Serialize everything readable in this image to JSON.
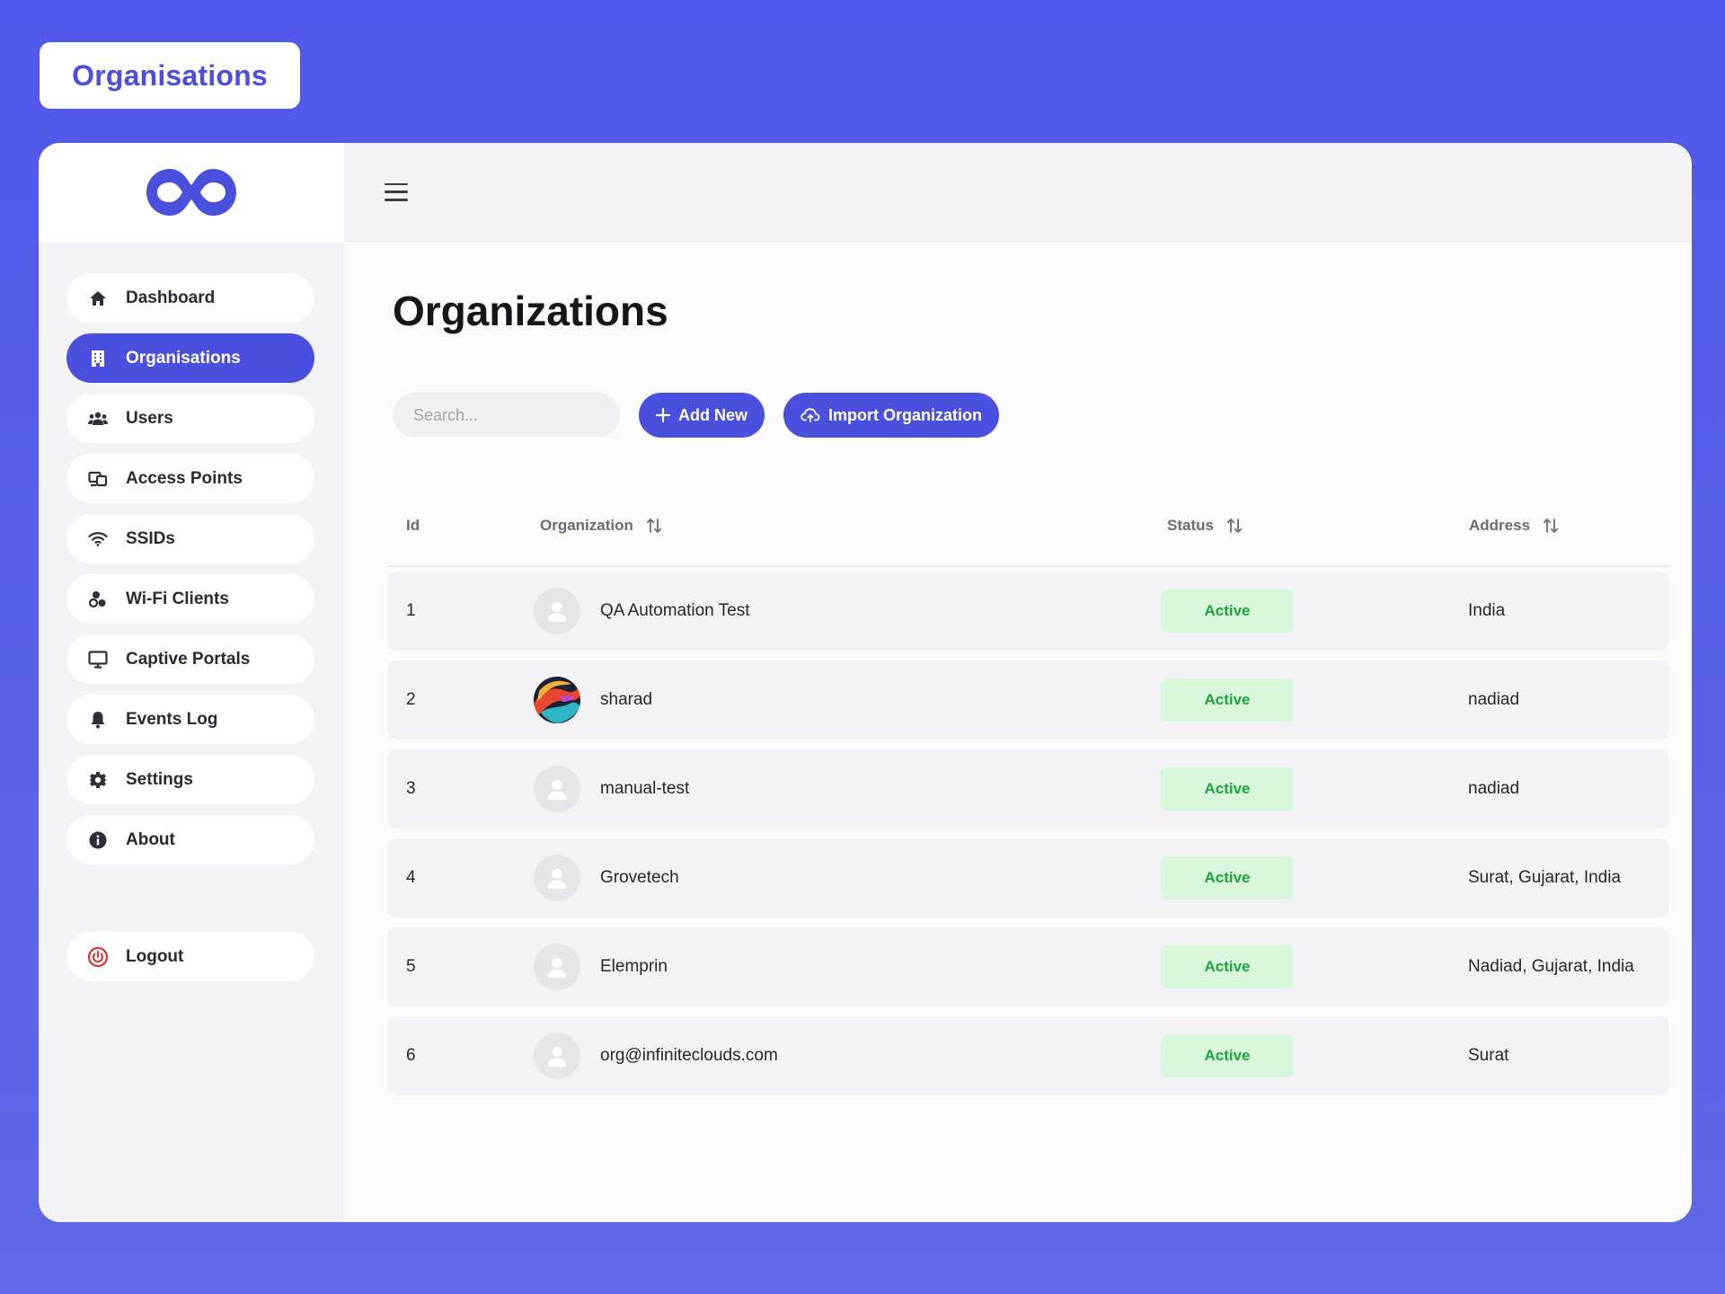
{
  "page_badge": "Organisations",
  "brand": {
    "logo_icon": "infinity-logo-icon",
    "accent": "#4a4fde"
  },
  "sidebar": {
    "items": [
      {
        "label": "Dashboard",
        "icon": "home-icon"
      },
      {
        "label": "Organisations",
        "icon": "building-icon",
        "active": true
      },
      {
        "label": "Users",
        "icon": "users-icon"
      },
      {
        "label": "Access Points",
        "icon": "access-point-icon"
      },
      {
        "label": "SSIDs",
        "icon": "wifi-icon"
      },
      {
        "label": "Wi-Fi Clients",
        "icon": "clients-icon"
      },
      {
        "label": "Captive Portals",
        "icon": "monitor-icon"
      },
      {
        "label": "Events Log",
        "icon": "bell-icon"
      },
      {
        "label": "Settings",
        "icon": "gear-icon"
      },
      {
        "label": "About",
        "icon": "info-icon"
      }
    ],
    "logout": {
      "label": "Logout",
      "icon": "power-icon"
    }
  },
  "header": {
    "menu_icon": "hamburger-icon"
  },
  "main": {
    "title": "Organizations",
    "search": {
      "placeholder": "Search...",
      "value": ""
    },
    "add_new_label": "Add New",
    "import_label": "Import Organization"
  },
  "table": {
    "columns": [
      {
        "label": "Id",
        "sortable": false
      },
      {
        "label": "Organization",
        "sortable": true
      },
      {
        "label": "Status",
        "sortable": true
      },
      {
        "label": "Address",
        "sortable": true
      }
    ],
    "rows": [
      {
        "id": "1",
        "name": "QA Automation Test",
        "avatar": "default-avatar-icon",
        "status": "Active",
        "address": "India"
      },
      {
        "id": "2",
        "name": "sharad",
        "avatar": "colorful-avatar-image",
        "status": "Active",
        "address": "nadiad"
      },
      {
        "id": "3",
        "name": "manual-test",
        "avatar": "default-avatar-icon",
        "status": "Active",
        "address": "nadiad"
      },
      {
        "id": "4",
        "name": "Grovetech",
        "avatar": "default-avatar-icon",
        "status": "Active",
        "address": "Surat, Gujarat, India"
      },
      {
        "id": "5",
        "name": "Elemprin",
        "avatar": "default-avatar-icon",
        "status": "Active",
        "address": "Nadiad, Gujarat, India"
      },
      {
        "id": "6",
        "name": "org@infiniteclouds.com",
        "avatar": "default-avatar-icon",
        "status": "Active",
        "address": "Surat"
      }
    ]
  },
  "colors": {
    "background": "#5157ea",
    "status_active_bg": "#d8f7dc",
    "status_active_text": "#1fa33b",
    "logout_icon": "#e0342c"
  }
}
